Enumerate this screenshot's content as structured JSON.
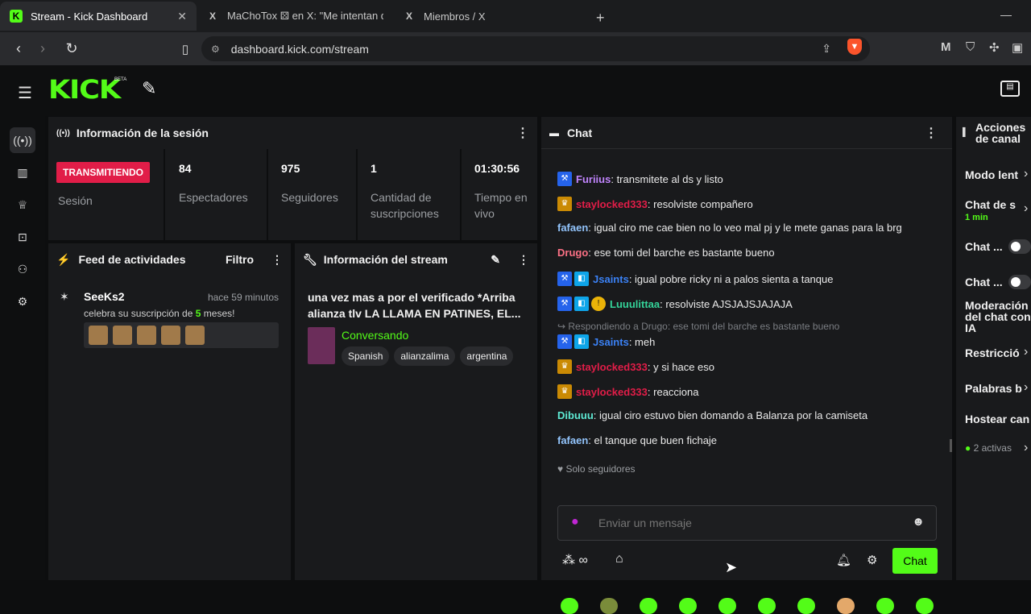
{
  "tabs": [
    {
      "icon": "K",
      "title": "Stream - Kick Dashboard",
      "active": true
    },
    {
      "icon": "X",
      "title": "MaChoTox ⚄ en X: \"Me intentan dar",
      "active": false
    },
    {
      "icon": "X",
      "title": "Miembros / X",
      "active": false
    }
  ],
  "newtab": "+",
  "url": "dashboard.kick.com/stream",
  "brand": {
    "logo": "KICK",
    "beta": "BETA"
  },
  "session": {
    "title": "Información de la sesión",
    "badge": "TRANSMITIENDO",
    "badge_label": "Sesión",
    "stats": [
      {
        "value": "84",
        "label": "Espectadores"
      },
      {
        "value": "975",
        "label": "Seguidores"
      },
      {
        "value": "1",
        "label": "Cantidad de suscripciones"
      },
      {
        "value": "01:30:56",
        "label": "Tiempo en vivo"
      }
    ]
  },
  "feed": {
    "title": "Feed de actividades",
    "filter": "Filtro",
    "item": {
      "user": "SeeKs2",
      "time": "hace 59 minutos",
      "text_prefix": "celebra su suscripción de ",
      "months": "5",
      "text_suffix": " meses!"
    }
  },
  "stream_info": {
    "title": "Información del stream",
    "stream_title": "una vez mas a por el verificado *Arriba alianza tlv LA LLAMA EN PATINES, EL...",
    "category": "Conversando",
    "tags": [
      "Spanish",
      "alianzalima",
      "argentina"
    ]
  },
  "chat": {
    "title": "Chat",
    "messages": [
      {
        "user": "Furiius",
        "color": "#c084fc",
        "text": ": transmitete al ds y listo",
        "icons": [
          "p"
        ]
      },
      {
        "user": "staylocked333",
        "color": "#e11d48",
        "text": ": resolviste compañero",
        "icons": [
          "g"
        ]
      },
      {
        "user": "fafaen",
        "color": "#93c5fd",
        "text": ": igual ciro me cae bien no lo veo mal pj y le mete ganas para la brg",
        "icons": []
      },
      {
        "user": "Drugo",
        "color": "#fb7185",
        "text": ": ese tomi del barche es bastante bueno",
        "icons": []
      },
      {
        "user": "Jsaints",
        "color": "#3b82f6",
        "text": ": igual pobre ricky ni a palos sienta a tanque",
        "icons": [
          "p",
          "t"
        ]
      },
      {
        "user": "Luuulittaa",
        "color": "#34d399",
        "text": ": resolviste AJSJAJSJAJAJA",
        "icons": [
          "p",
          "t",
          "o"
        ]
      },
      {
        "user": "Jsaints",
        "color": "#3b82f6",
        "text": ": meh",
        "icons": [
          "p",
          "t"
        ]
      },
      {
        "user": "staylocked333",
        "color": "#e11d48",
        "text": ": y si hace eso",
        "icons": [
          "g"
        ]
      },
      {
        "user": "staylocked333",
        "color": "#e11d48",
        "text": ": reacciona",
        "icons": [
          "g"
        ]
      },
      {
        "user": "Dibuuu",
        "color": "#5eead4",
        "text": ": igual ciro estuvo bien domando a Balanza por la camiseta",
        "icons": []
      },
      {
        "user": "fafaen",
        "color": "#93c5fd",
        "text": ": el tanque que buen fichaje",
        "icons": []
      }
    ],
    "reply_note": "Respondiendo a Drugo: ese tomi del barche es bastante bueno",
    "followers_only": "Solo seguidores",
    "placeholder": "Enviar un mensaje",
    "send": "Chat",
    "accent": "#53fc18"
  },
  "actions": {
    "title": "Acciones de canal",
    "items": [
      {
        "label": "Modo lent"
      },
      {
        "label": "Chat de s",
        "sub": "1 min"
      },
      {
        "label": "Chat ..."
      },
      {
        "label": "Chat ..."
      },
      {
        "label": "Moderación del chat con IA"
      },
      {
        "label": "Restricció"
      },
      {
        "label": "Palabras b"
      },
      {
        "label": "Hostear can"
      }
    ],
    "active_count": "2 activas"
  }
}
